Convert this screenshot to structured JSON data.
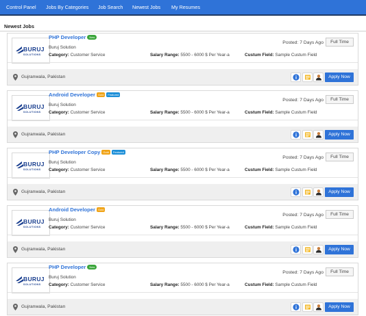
{
  "nav": {
    "items": [
      "Control Panel",
      "Jobs By Categories",
      "Job Search",
      "Newest Jobs",
      "My Resumes"
    ]
  },
  "section_title": "Newest Jobs",
  "colors": {
    "nav": "#2f73d8",
    "accent": "#2f73d8",
    "new": "#3aa53a",
    "gold": "#f0a316",
    "featured": "#1d8fd8"
  },
  "labels": {
    "category": "Category:",
    "salary": "Salary Range:",
    "custom": "Custum Field:",
    "apply": "Apply Now"
  },
  "jobs": [
    {
      "title": "PHP Developer",
      "badges": [
        {
          "text": "New",
          "kind": "new"
        }
      ],
      "posted": "Posted: 7 Days Ago",
      "type": "Full Time",
      "company": "Buruj Solution",
      "category": "Customer Service",
      "salary": "5500 - 6000 $ Per Year-a",
      "custom": "Sample Custum Field",
      "location": "Gujranwala, Pakistan",
      "logo_text": "BURUJ SOLUTIONS"
    },
    {
      "title": "Android Developer",
      "badges": [
        {
          "text": "Gold",
          "kind": "gold"
        },
        {
          "text": "Featured",
          "kind": "featured"
        }
      ],
      "posted": "Posted: 7 Days Ago",
      "type": "Full Time",
      "company": "Buruj Solution",
      "category": "Customer Service",
      "salary": "5500 - 6000 $ Per Year-a",
      "custom": "Sample Custum Field",
      "location": "Gujranwala, Pakistan",
      "logo_text": "BURUJ SOLUTIONS"
    },
    {
      "title": "PHP Developer Copy",
      "badges": [
        {
          "text": "Gold",
          "kind": "gold"
        },
        {
          "text": "Featured",
          "kind": "featured"
        }
      ],
      "posted": "Posted: 7 Days Ago",
      "type": "Full Time",
      "company": "Buruj Solution",
      "category": "Customer Service",
      "salary": "5500 - 6000 $ Per Year-a",
      "custom": "Sample Custum Field",
      "location": "Gujranwala, Pakistan",
      "logo_text": "BURUJ SOLUTIONS"
    },
    {
      "title": "Android Developer",
      "badges": [
        {
          "text": "Gold",
          "kind": "gold"
        }
      ],
      "posted": "Posted: 7 Days Ago",
      "type": "Full Time",
      "company": "Buruj Solution",
      "category": "Customer Service",
      "salary": "5500 - 6000 $ Per Year-a",
      "custom": "Sample Custum Field",
      "location": "Gujranwala, Pakistan",
      "logo_text": "BURUJ SOLUTIONS"
    },
    {
      "title": "PHP Developer",
      "badges": [
        {
          "text": "New",
          "kind": "new"
        }
      ],
      "posted": "Posted: 7 Days Ago",
      "type": "Full Time",
      "company": "Buruj Solution",
      "category": "Customer Service",
      "salary": "5500 - 6000 $ Per Year-a",
      "custom": "Sample Custum Field",
      "location": "Gujranwala, Pakistan",
      "logo_text": "BURUJ SOLUTIONS"
    }
  ]
}
